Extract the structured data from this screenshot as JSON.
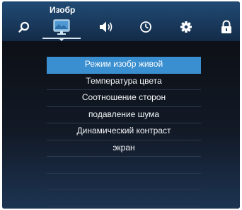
{
  "header": {
    "title": "Изобр"
  },
  "tabs": [
    {
      "icon": "search-icon"
    },
    {
      "icon": "picture-monitor-icon",
      "active": true
    },
    {
      "icon": "speaker-icon"
    },
    {
      "icon": "clock-icon"
    },
    {
      "icon": "gear-icon"
    },
    {
      "icon": "lock-icon"
    }
  ],
  "menu": {
    "items": [
      {
        "label": "Режим изобр живой",
        "selected": true
      },
      {
        "label": "Температура цвета"
      },
      {
        "label": "Соотношение сторон"
      },
      {
        "label": "подавление шума"
      },
      {
        "label": "Динамический контраст"
      },
      {
        "label": "экран"
      }
    ]
  },
  "colors": {
    "accent": "#3a8fd0",
    "header_bg": "#1b3d61",
    "panel_bg": "#0f1219"
  }
}
